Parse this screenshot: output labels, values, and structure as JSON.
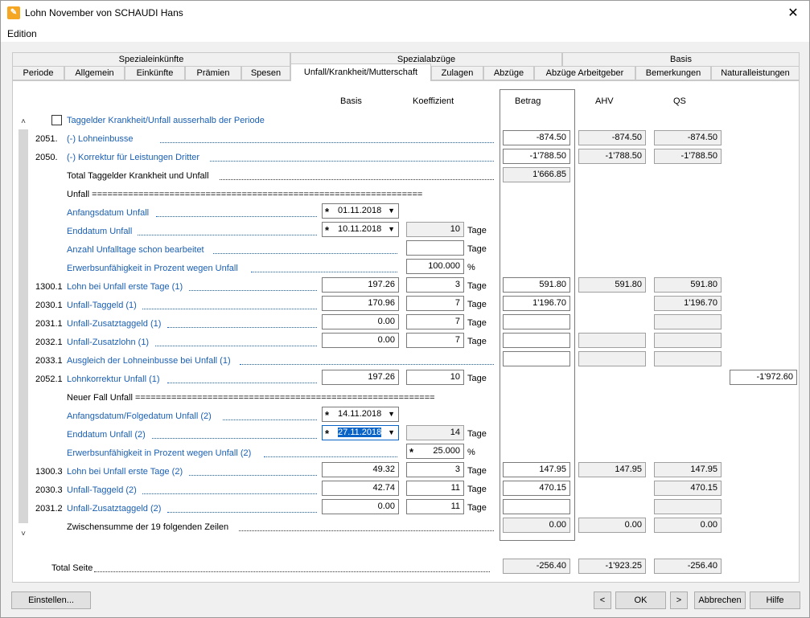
{
  "window": {
    "title": "Lohn November von SCHAUDI Hans",
    "close_glyph": "✕",
    "icon": "app-icon"
  },
  "menu": {
    "edition": "Edition"
  },
  "tab_groups": {
    "spezialeinkuenfte": "Spezialeinkünfte",
    "spezialabzuege": "Spezialabzüge",
    "basis": "Basis"
  },
  "tabs": [
    "Periode",
    "Allgemein",
    "Einkünfte",
    "Prämien",
    "Spesen",
    "Unfall/Krankheit/Mutterschaft",
    "Zulagen",
    "Abzüge",
    "Abzüge Arbeitgeber",
    "Bemerkungen",
    "Naturalleistungen"
  ],
  "headers": {
    "basis": "Basis",
    "koeffizient": "Koeffizient",
    "betrag": "Betrag",
    "ahv": "AHV",
    "qs": "QS"
  },
  "checkbox_label": "Taggelder Krankheit/Unfall ausserhalb der Periode",
  "rows": {
    "r2051": {
      "code": "2051.",
      "label": "(-) Lohneinbusse",
      "betrag": "-874.50",
      "ahv": "-874.50",
      "qs": "-874.50"
    },
    "r2050": {
      "code": "2050.",
      "label": "(-) Korrektur für Leistungen Dritter",
      "betrag": "-1'788.50",
      "ahv": "-1'788.50",
      "qs": "-1'788.50"
    },
    "total_tg": {
      "label": "Total Taggelder Krankheit und Unfall",
      "betrag": "1'666.85"
    },
    "unfall_sep": {
      "label": "Unfall ================================================================"
    },
    "anfang": {
      "label": "Anfangsdatum Unfall",
      "date": "01.11.2018"
    },
    "end": {
      "label": "Enddatum Unfall",
      "date": "10.11.2018",
      "koef": "10",
      "unit": "Tage"
    },
    "anzahl": {
      "label": "Anzahl Unfalltage schon bearbeitet",
      "koef": "",
      "unit": "Tage"
    },
    "erwerb": {
      "label": "Erwerbsunfähigkeit in Prozent wegen Unfall",
      "koef": "100.000",
      "unit": "%"
    },
    "r1300_1": {
      "code": "1300.1",
      "label": "Lohn bei Unfall erste Tage (1)",
      "basis": "197.26",
      "koef": "3",
      "unit": "Tage",
      "betrag": "591.80",
      "ahv": "591.80",
      "qs": "591.80"
    },
    "r2030_1": {
      "code": "2030.1",
      "label": "Unfall-Taggeld (1)",
      "basis": "170.96",
      "koef": "7",
      "unit": "Tage",
      "betrag": "1'196.70",
      "qs": "1'196.70"
    },
    "r2031_1": {
      "code": "2031.1",
      "label": "Unfall-Zusatztaggeld (1)",
      "basis": "0.00",
      "koef": "7",
      "unit": "Tage"
    },
    "r2032_1": {
      "code": "2032.1",
      "label": "Unfall-Zusatzlohn (1)",
      "basis": "0.00",
      "koef": "7",
      "unit": "Tage"
    },
    "r2033_1": {
      "code": "2033.1",
      "label": "Ausgleich der Lohneinbusse bei Unfall (1)"
    },
    "r2052_1": {
      "code": "2052.1",
      "label": "Lohnkorrektur Unfall (1)",
      "basis": "197.26",
      "koef": "10",
      "unit": "Tage",
      "extra": "-1'972.60"
    },
    "neuer_sep": {
      "label": "Neuer Fall Unfall =========================================================="
    },
    "anfang2": {
      "label": "Anfangsdatum/Folgedatum Unfall (2)",
      "date": "14.11.2018"
    },
    "end2": {
      "label": "Enddatum Unfall (2)",
      "date_d": "27",
      "date_m": "11",
      "date_y": "2018",
      "koef": "14",
      "unit": "Tage"
    },
    "erwerb2": {
      "label": "Erwerbsunfähigkeit in Prozent wegen Unfall (2)",
      "koef": "25.000",
      "unit": "%"
    },
    "r1300_3": {
      "code": "1300.3",
      "label": "Lohn bei Unfall erste Tage (2)",
      "basis": "49.32",
      "koef": "3",
      "unit": "Tage",
      "betrag": "147.95",
      "ahv": "147.95",
      "qs": "147.95"
    },
    "r2030_3": {
      "code": "2030.3",
      "label": "Unfall-Taggeld (2)",
      "basis": "42.74",
      "koef": "11",
      "unit": "Tage",
      "betrag": "470.15",
      "qs": "470.15"
    },
    "r2031_2": {
      "code": "2031.2",
      "label": "Unfall-Zusatztaggeld (2)",
      "basis": "0.00",
      "koef": "11",
      "unit": "Tage"
    },
    "zwischen": {
      "label": "Zwischensumme der 19 folgenden Zeilen",
      "betrag": "0.00",
      "ahv": "0.00",
      "qs": "0.00"
    }
  },
  "total": {
    "label": "Total Seite",
    "betrag": "-256.40",
    "ahv": "-1'923.25",
    "qs": "-256.40"
  },
  "buttons": {
    "einstellen": "Einstellen...",
    "prev": "<",
    "ok": "OK",
    "next": ">",
    "abbrechen": "Abbrechen",
    "hilfe": "Hilfe"
  },
  "scroll": {
    "up": "˄",
    "down": "˅"
  }
}
